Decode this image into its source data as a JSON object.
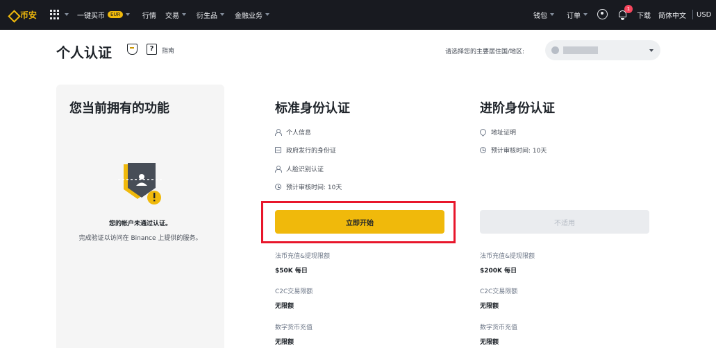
{
  "topnav": {
    "logo_text": "币安",
    "items": [
      {
        "label": "一键买币",
        "badge": "EUR"
      },
      {
        "label": "行情"
      },
      {
        "label": "交易"
      },
      {
        "label": "衍生品"
      },
      {
        "label": "金融业务"
      }
    ],
    "right": {
      "wallet": "钱包",
      "orders": "订单",
      "notification_count": "1",
      "download": "下载",
      "language": "简体中文",
      "currency": "USD"
    },
    "icons": [
      "binance-logo-icon",
      "apps-grid-icon",
      "user-icon",
      "bell-icon"
    ]
  },
  "header": {
    "title": "个人认证",
    "guide": "指南",
    "region_label": "请选择您的主要居住国/地区:"
  },
  "left_card": {
    "title": "您当前拥有的功能",
    "status_title": "您的帐户未通过认证。",
    "status_desc": "完成验证以访问在 Binance 上提供的服务。"
  },
  "standard": {
    "title": "标准身份认证",
    "requirements": [
      "个人信息",
      "政府发行的身份证",
      "人脸识别认证",
      "预计审核时间: 10天"
    ],
    "button": "立即开始",
    "limits": [
      {
        "label": "法币充值&提现限额",
        "value": "$50K 每日"
      },
      {
        "label": "C2C交易限额",
        "value": "无限额"
      },
      {
        "label": "数字货币充值",
        "value": "无限额"
      }
    ]
  },
  "advanced": {
    "title": "进阶身份认证",
    "requirements": [
      "地址证明",
      "预计审核时间: 10天"
    ],
    "button": "不适用",
    "limits": [
      {
        "label": "法币充值&提现限额",
        "value": "$200K 每日"
      },
      {
        "label": "C2C交易限额",
        "value": "无限额"
      },
      {
        "label": "数字货币充值",
        "value": "无限额"
      }
    ]
  },
  "colors": {
    "nav_bg": "#181a20",
    "accent": "#f0b90b",
    "highlight": "#e8162b",
    "card_bg": "#f5f5f5"
  }
}
